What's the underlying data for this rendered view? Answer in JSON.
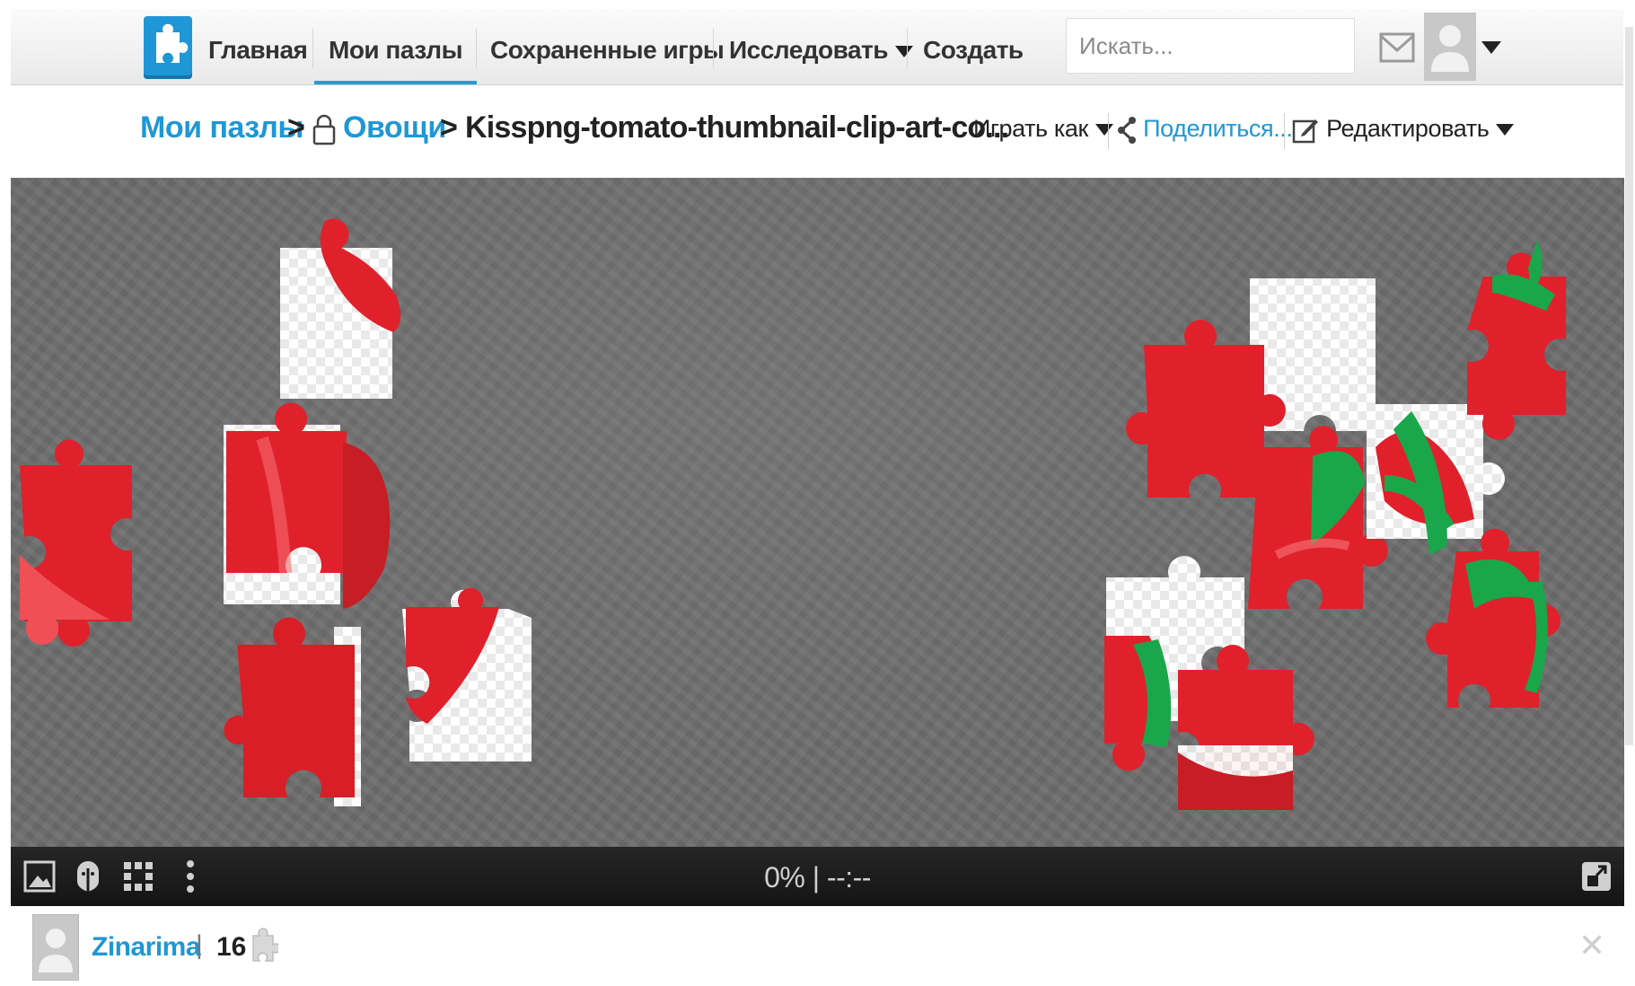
{
  "nav": {
    "home": "Главная",
    "my_puzzles": "Мои пазлы",
    "saved_games": "Сохраненные игры",
    "explore": "Исследовать",
    "create": "Создать",
    "search_placeholder": "Искать..."
  },
  "breadcrumb": {
    "root": "Мои пазлы",
    "sep1": ">",
    "folder": "Овощи",
    "sep2": ">",
    "title": "Kisspng-tomato-thumbnail-clip-art-co..."
  },
  "actions": {
    "play_as": "Играть как",
    "share": "Поделиться...",
    "edit": "Редактировать"
  },
  "toolbar": {
    "progress": "0% | --:--"
  },
  "footer": {
    "author": "Zinarima",
    "separator": "|",
    "piece_count": "16"
  },
  "colors": {
    "accent": "#1f97d6",
    "tomato_red": "#e0212b",
    "leaf_green": "#1aa64a",
    "board_gray": "#6e6e6e"
  },
  "icons": [
    "puzzle-logo-icon",
    "mail-icon",
    "user-avatar-icon",
    "lock-icon",
    "share-icon",
    "edit-icon",
    "image-icon",
    "ghost-icon",
    "grid-icon",
    "more-icon",
    "fullscreen-icon",
    "puzzle-piece-icon",
    "close-icon"
  ]
}
